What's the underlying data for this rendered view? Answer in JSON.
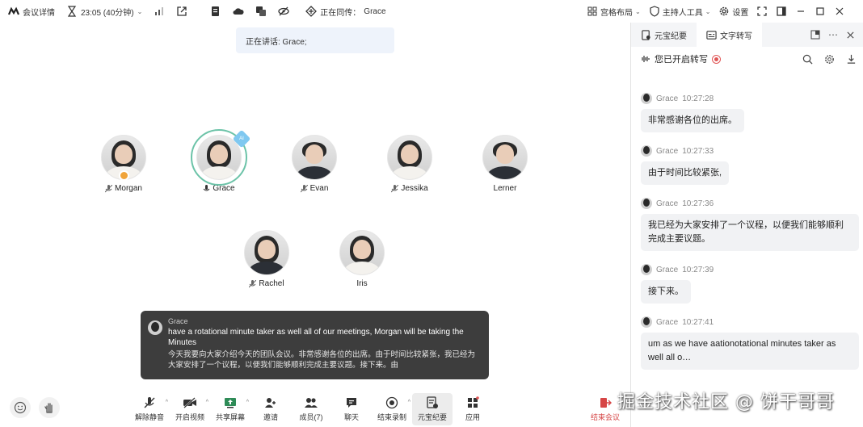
{
  "topbar": {
    "meeting_details": "会议详情",
    "timer": "23:05 (40分钟)",
    "transmitting": "正在同传：",
    "transmitting_name": "Grace"
  },
  "topright": {
    "layout": "宫格布局",
    "host_tools": "主持人工具",
    "settings": "设置"
  },
  "speaking": "正在讲话: Grace;",
  "participants": [
    {
      "name": "Morgan"
    },
    {
      "name": "Grace"
    },
    {
      "name": "Evan"
    },
    {
      "name": "Jessika"
    },
    {
      "name": "Lerner"
    },
    {
      "name": "Rachel"
    },
    {
      "name": "Iris"
    }
  ],
  "ai_badge": "AI",
  "caption": {
    "speaker": "Grace",
    "english": "have a rotational minute taker as well all of our meetings, Morgan will be taking the Minutes",
    "chinese": "今天我要向大家介绍今天的团队会议。非常感谢各位的出席。由于时间比较紧张，我已经为大家安排了一个议程，以便我们能够顺利完成主要议题。接下来。由"
  },
  "toolbar": {
    "unmute": "解除静音",
    "video": "开启视频",
    "share": "共享屏幕",
    "invite": "邀请",
    "members": "成员(7)",
    "chat": "聊天",
    "record": "结束录制",
    "minutes": "元宝纪要",
    "apps": "应用",
    "end": "结束会议"
  },
  "watermark": "掘金技术社区 @ 饼干哥哥",
  "panel": {
    "tab_minutes": "元宝纪要",
    "tab_transcript": "文字转写",
    "transcribing": "您已开启转写",
    "messages": [
      {
        "name": "Grace",
        "time": "10:27:28",
        "text": "非常感谢各位的出席。"
      },
      {
        "name": "Grace",
        "time": "10:27:33",
        "text": "由于时间比较紧张,"
      },
      {
        "name": "Grace",
        "time": "10:27:36",
        "text": "我已经为大家安排了一个议程，以便我们能够顺利完成主要议题。"
      },
      {
        "name": "Grace",
        "time": "10:27:39",
        "text": "接下来。"
      },
      {
        "name": "Grace",
        "time": "10:27:41",
        "text": "um as we have aationotational minutes taker as well all o…"
      }
    ]
  }
}
